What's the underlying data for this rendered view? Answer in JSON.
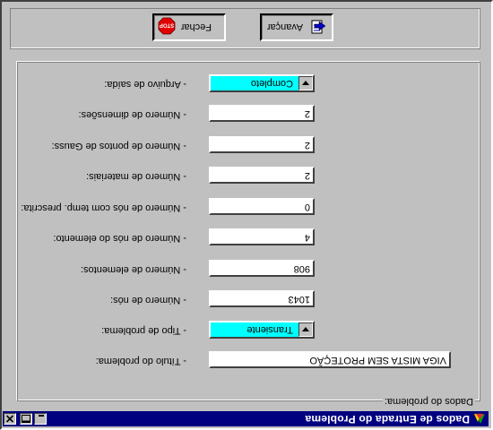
{
  "window": {
    "title": "Dados de Entrada do Problema",
    "minimize_icon": "minimize-icon",
    "maximize_icon": "maximize-icon",
    "close_icon": "close-icon"
  },
  "group": {
    "legend": "Dados do problema:"
  },
  "fields": {
    "titulo": {
      "label": "- Título do problema:",
      "value": "VIGA MISTA SEM PROTEÇÃO"
    },
    "tipo": {
      "label": "- Tipo de problema:",
      "value": "Transiente"
    },
    "nos": {
      "label": "- Número de nós:",
      "value": "1043"
    },
    "elementos": {
      "label": "- Número de elementos:",
      "value": "908"
    },
    "nos_elemento": {
      "label": "- Número de nós do elemento:",
      "value": "4"
    },
    "nos_temp": {
      "label": "- Número de nós com temp. prescrita:",
      "value": "0"
    },
    "materiais": {
      "label": "- Número de materiais:",
      "value": "2"
    },
    "pontos_gauss": {
      "label": "- Número de pontos de Gauss:",
      "value": "2"
    },
    "dimensoes": {
      "label": "- Número de dimensões:",
      "value": "2"
    },
    "arquivo": {
      "label": "- Arquivo de saída:",
      "value": "Completo"
    }
  },
  "buttons": {
    "avancar": "Avançar",
    "fechar": "Fechar",
    "stop_text": "STOP"
  },
  "colors": {
    "titlebar": "#000080",
    "select_highlight": "#00ffff",
    "face": "#c0c0c0"
  }
}
